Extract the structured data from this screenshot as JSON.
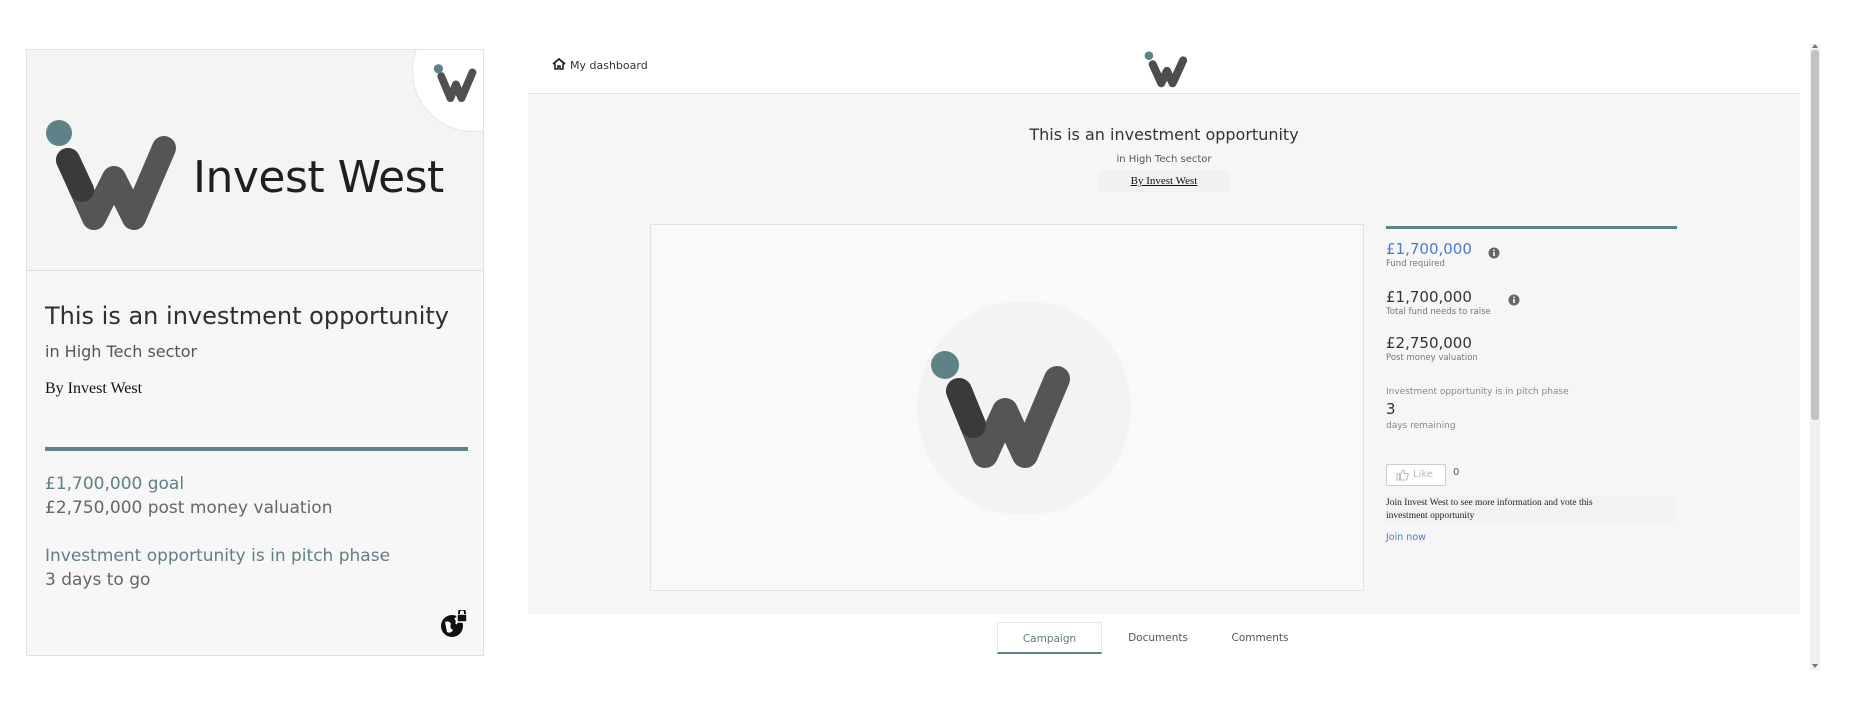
{
  "card": {
    "brand_name": "Invest West",
    "title": "This is an investment opportunity",
    "sector": "in High Tech sector",
    "by": "By Invest West",
    "goal": "£1,700,000 goal",
    "post_money": "£2,750,000 post money valuation",
    "phase": "Investment opportunity is in pitch phase",
    "days_to_go": "3 days to go"
  },
  "page": {
    "dashboard_link": "My dashboard",
    "title": "This is an investment opportunity",
    "sector": "in High Tech sector",
    "by": "By Invest West",
    "stats": {
      "fund_required_value": "£1,700,000",
      "fund_required_label": "Fund required",
      "total_fund_value": "£1,700,000",
      "total_fund_label": "Total fund needs to raise",
      "post_money_value": "£2,750,000",
      "post_money_label": "Post money valuation",
      "phase_text": "Investment opportunity is in pitch phase",
      "days_number": "3",
      "days_label": "days remaining",
      "like_label": "Like",
      "like_count": "0",
      "join_text": "Join Invest West to see more information and vote this investment opportunity",
      "join_link": "Join now"
    },
    "tabs": [
      {
        "label": "Campaign",
        "active": true
      },
      {
        "label": "Documents",
        "active": false
      },
      {
        "label": "Comments",
        "active": false
      }
    ]
  },
  "colors": {
    "brand_teal": "#5d8388",
    "logo_gray": "#555555",
    "logo_dot": "#5d8388",
    "link_blue": "#4a7bd0"
  },
  "icons": [
    "invest-west-logo",
    "home-icon",
    "info-icon",
    "thumbs-up-icon",
    "globe-lock-icon"
  ]
}
